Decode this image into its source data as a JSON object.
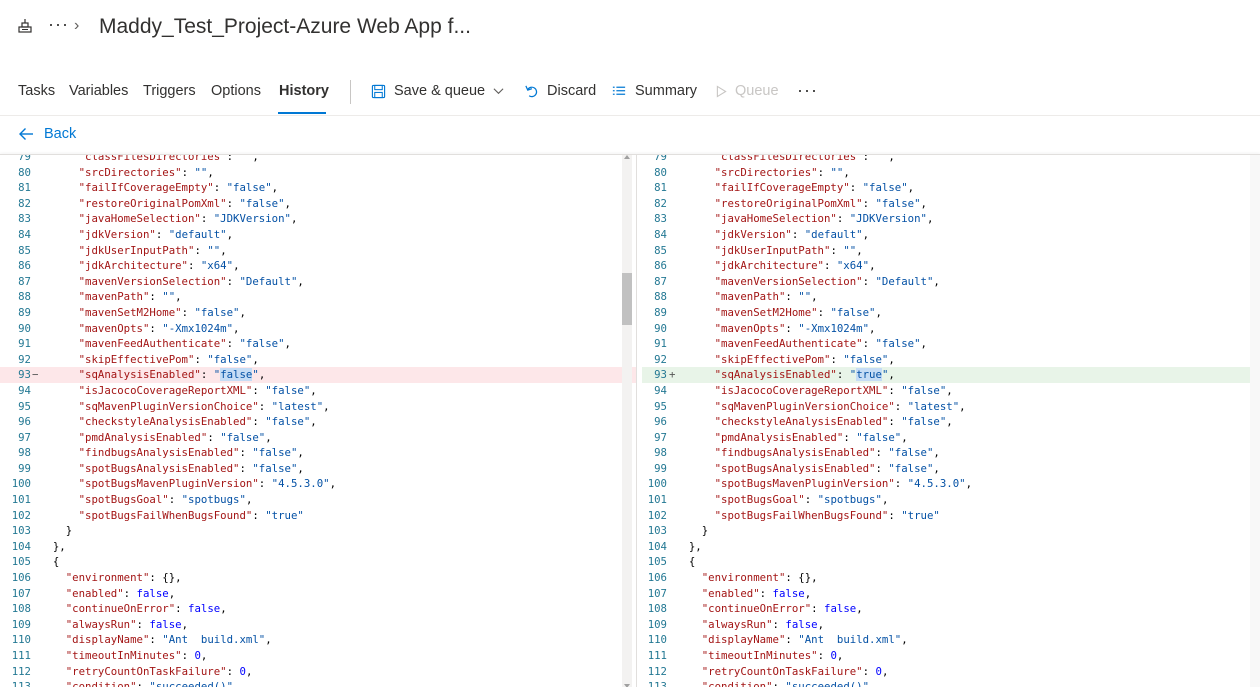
{
  "header": {
    "title": "Maddy_Test_Project-Azure Web App f...",
    "app_icon": "pipeline-icon",
    "more": "···",
    "chevron": "›"
  },
  "tabs": [
    {
      "label": "Tasks",
      "active": false
    },
    {
      "label": "Variables",
      "active": false
    },
    {
      "label": "Triggers",
      "active": false
    },
    {
      "label": "Options",
      "active": false
    },
    {
      "label": "History",
      "active": true
    }
  ],
  "commands": {
    "save_queue": "Save & queue",
    "discard": "Discard",
    "summary": "Summary",
    "queue": "Queue",
    "more": "···"
  },
  "back": {
    "label": "Back"
  },
  "diff": {
    "left_lines": [
      {
        "n": "79",
        "t": "      \"classFilesDirectories\": \"\","
      },
      {
        "n": "80",
        "t": "      \"srcDirectories\": \"\","
      },
      {
        "n": "81",
        "t": "      \"failIfCoverageEmpty\": \"false\","
      },
      {
        "n": "82",
        "t": "      \"restoreOriginalPomXml\": \"false\","
      },
      {
        "n": "83",
        "t": "      \"javaHomeSelection\": \"JDKVersion\","
      },
      {
        "n": "84",
        "t": "      \"jdkVersion\": \"default\","
      },
      {
        "n": "85",
        "t": "      \"jdkUserInputPath\": \"\","
      },
      {
        "n": "86",
        "t": "      \"jdkArchitecture\": \"x64\","
      },
      {
        "n": "87",
        "t": "      \"mavenVersionSelection\": \"Default\","
      },
      {
        "n": "88",
        "t": "      \"mavenPath\": \"\","
      },
      {
        "n": "89",
        "t": "      \"mavenSetM2Home\": \"false\","
      },
      {
        "n": "90",
        "t": "      \"mavenOpts\": \"-Xmx1024m\","
      },
      {
        "n": "91",
        "t": "      \"mavenFeedAuthenticate\": \"false\","
      },
      {
        "n": "92",
        "t": "      \"skipEffectivePom\": \"false\","
      },
      {
        "n": "93",
        "t": "      \"sqAnalysisEnabled\": \"false\",",
        "type": "removed"
      },
      {
        "n": "94",
        "t": "      \"isJacocoCoverageReportXML\": \"false\","
      },
      {
        "n": "95",
        "t": "      \"sqMavenPluginVersionChoice\": \"latest\","
      },
      {
        "n": "96",
        "t": "      \"checkstyleAnalysisEnabled\": \"false\","
      },
      {
        "n": "97",
        "t": "      \"pmdAnalysisEnabled\": \"false\","
      },
      {
        "n": "98",
        "t": "      \"findbugsAnalysisEnabled\": \"false\","
      },
      {
        "n": "99",
        "t": "      \"spotBugsAnalysisEnabled\": \"false\","
      },
      {
        "n": "100",
        "t": "      \"spotBugsMavenPluginVersion\": \"4.5.3.0\","
      },
      {
        "n": "101",
        "t": "      \"spotBugsGoal\": \"spotbugs\","
      },
      {
        "n": "102",
        "t": "      \"spotBugsFailWhenBugsFound\": \"true\""
      },
      {
        "n": "103",
        "t": "    }"
      },
      {
        "n": "104",
        "t": "  },"
      },
      {
        "n": "105",
        "t": "  {"
      },
      {
        "n": "106",
        "t": "    \"environment\": {},"
      },
      {
        "n": "107",
        "t": "    \"enabled\": false,"
      },
      {
        "n": "108",
        "t": "    \"continueOnError\": false,"
      },
      {
        "n": "109",
        "t": "    \"alwaysRun\": false,"
      },
      {
        "n": "110",
        "t": "    \"displayName\": \"Ant  build.xml\","
      },
      {
        "n": "111",
        "t": "    \"timeoutInMinutes\": 0,"
      },
      {
        "n": "112",
        "t": "    \"retryCountOnTaskFailure\": 0,"
      },
      {
        "n": "113",
        "t": "    \"condition\": \"succeeded()\","
      }
    ],
    "right_lines": [
      {
        "n": "79",
        "t": "      \"classFilesDirectories\": \"\","
      },
      {
        "n": "80",
        "t": "      \"srcDirectories\": \"\","
      },
      {
        "n": "81",
        "t": "      \"failIfCoverageEmpty\": \"false\","
      },
      {
        "n": "82",
        "t": "      \"restoreOriginalPomXml\": \"false\","
      },
      {
        "n": "83",
        "t": "      \"javaHomeSelection\": \"JDKVersion\","
      },
      {
        "n": "84",
        "t": "      \"jdkVersion\": \"default\","
      },
      {
        "n": "85",
        "t": "      \"jdkUserInputPath\": \"\","
      },
      {
        "n": "86",
        "t": "      \"jdkArchitecture\": \"x64\","
      },
      {
        "n": "87",
        "t": "      \"mavenVersionSelection\": \"Default\","
      },
      {
        "n": "88",
        "t": "      \"mavenPath\": \"\","
      },
      {
        "n": "89",
        "t": "      \"mavenSetM2Home\": \"false\","
      },
      {
        "n": "90",
        "t": "      \"mavenOpts\": \"-Xmx1024m\","
      },
      {
        "n": "91",
        "t": "      \"mavenFeedAuthenticate\": \"false\","
      },
      {
        "n": "92",
        "t": "      \"skipEffectivePom\": \"false\","
      },
      {
        "n": "93",
        "t": "      \"sqAnalysisEnabled\": \"true\",",
        "type": "added"
      },
      {
        "n": "94",
        "t": "      \"isJacocoCoverageReportXML\": \"false\","
      },
      {
        "n": "95",
        "t": "      \"sqMavenPluginVersionChoice\": \"latest\","
      },
      {
        "n": "96",
        "t": "      \"checkstyleAnalysisEnabled\": \"false\","
      },
      {
        "n": "97",
        "t": "      \"pmdAnalysisEnabled\": \"false\","
      },
      {
        "n": "98",
        "t": "      \"findbugsAnalysisEnabled\": \"false\","
      },
      {
        "n": "99",
        "t": "      \"spotBugsAnalysisEnabled\": \"false\","
      },
      {
        "n": "100",
        "t": "      \"spotBugsMavenPluginVersion\": \"4.5.3.0\","
      },
      {
        "n": "101",
        "t": "      \"spotBugsGoal\": \"spotbugs\","
      },
      {
        "n": "102",
        "t": "      \"spotBugsFailWhenBugsFound\": \"true\""
      },
      {
        "n": "103",
        "t": "    }"
      },
      {
        "n": "104",
        "t": "  },"
      },
      {
        "n": "105",
        "t": "  {"
      },
      {
        "n": "106",
        "t": "    \"environment\": {},"
      },
      {
        "n": "107",
        "t": "    \"enabled\": false,"
      },
      {
        "n": "108",
        "t": "    \"continueOnError\": false,"
      },
      {
        "n": "109",
        "t": "    \"alwaysRun\": false,"
      },
      {
        "n": "110",
        "t": "    \"displayName\": \"Ant  build.xml\","
      },
      {
        "n": "111",
        "t": "    \"timeoutInMinutes\": 0,"
      },
      {
        "n": "112",
        "t": "    \"retryCountOnTaskFailure\": 0,"
      },
      {
        "n": "113",
        "t": "    \"condition\": \"succeeded()\","
      }
    ],
    "removed_marker": "−",
    "added_marker": "+"
  },
  "colors": {
    "accent": "#0078d4",
    "removed_bg": "#fde7e9",
    "added_bg": "#e8f4e8",
    "key": "#a31515",
    "string": "#0451a5",
    "keyword": "#0000ff",
    "line_number": "#237893"
  }
}
